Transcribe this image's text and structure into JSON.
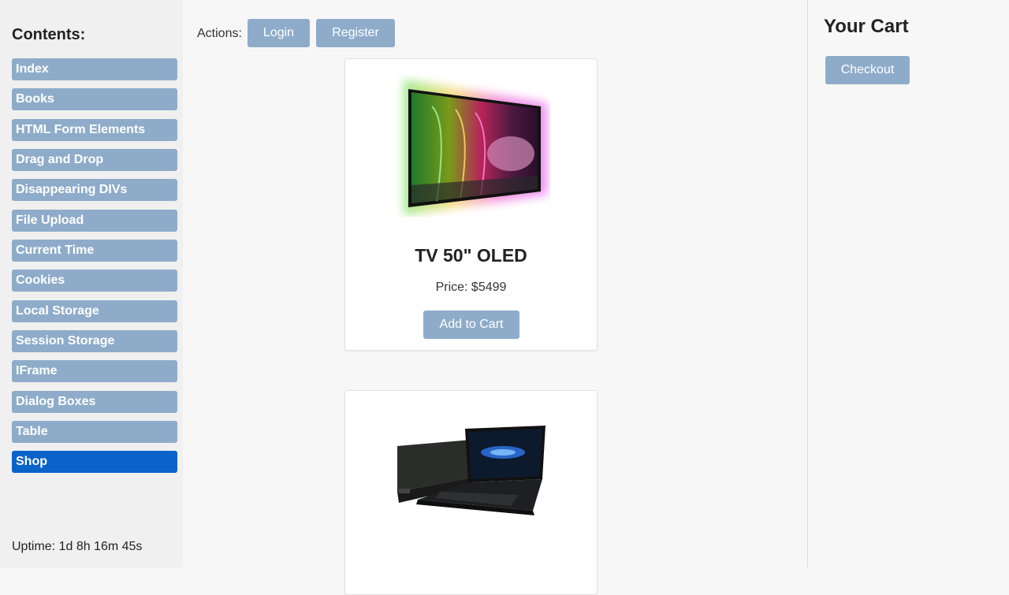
{
  "sidebar": {
    "title": "Contents:",
    "items": [
      {
        "label": "Index",
        "active": false
      },
      {
        "label": "Books",
        "active": false
      },
      {
        "label": "HTML Form Elements",
        "active": false
      },
      {
        "label": "Drag and Drop",
        "active": false
      },
      {
        "label": "Disappearing DIVs",
        "active": false
      },
      {
        "label": "File Upload",
        "active": false
      },
      {
        "label": "Current Time",
        "active": false
      },
      {
        "label": "Cookies",
        "active": false
      },
      {
        "label": "Local Storage",
        "active": false
      },
      {
        "label": "Session Storage",
        "active": false
      },
      {
        "label": "IFrame",
        "active": false
      },
      {
        "label": "Dialog Boxes",
        "active": false
      },
      {
        "label": "Table",
        "active": false
      },
      {
        "label": "Shop",
        "active": true
      }
    ],
    "uptime": "Uptime: 1d 8h 16m 45s"
  },
  "header": {
    "actions_label": "Actions:",
    "login_label": "Login",
    "register_label": "Register"
  },
  "products": [
    {
      "name": "TV 50\" OLED",
      "price": "Price: $5499",
      "add_label": "Add to Cart",
      "image": "oled-tv"
    },
    {
      "name": "",
      "price": "",
      "add_label": "",
      "image": "laptop"
    }
  ],
  "cart": {
    "title": "Your Cart",
    "checkout_label": "Checkout"
  },
  "colors": {
    "nav_bg": "#8eacca",
    "nav_active": "#0a63c9",
    "button_bg": "#8eacca"
  }
}
